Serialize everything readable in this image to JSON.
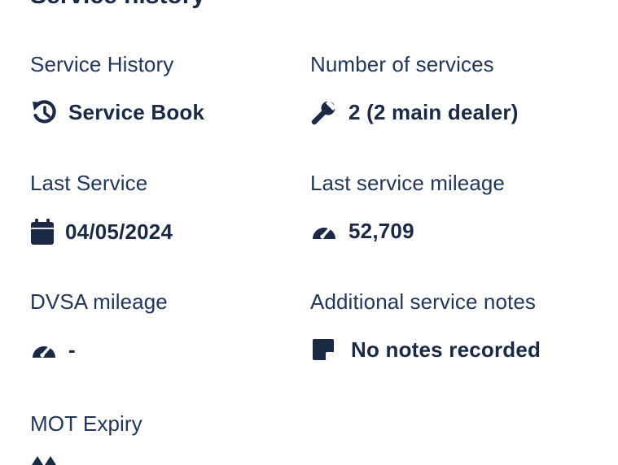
{
  "section": {
    "title": "Service history"
  },
  "fields": {
    "service_history": {
      "label": "Service History",
      "value": "Service Book",
      "icon": "history-icon"
    },
    "number_of_services": {
      "label": "Number of services",
      "value": "2 (2 main dealer)",
      "icon": "wrench-icon"
    },
    "last_service": {
      "label": "Last Service",
      "value": "04/05/2024",
      "icon": "calendar-icon"
    },
    "last_service_mileage": {
      "label": "Last service mileage",
      "value": "52,709",
      "icon": "speedometer-icon"
    },
    "dvsa_mileage": {
      "label": "DVSA mileage",
      "value": "-",
      "icon": "speedometer-icon"
    },
    "additional_service_notes": {
      "label": "Additional service notes",
      "value": "No notes recorded",
      "icon": "sticky-note-icon"
    },
    "mot_expiry": {
      "label": "MOT Expiry",
      "icon": "mot-icon"
    }
  },
  "colors": {
    "text": "#1b2a44",
    "label": "#22365a",
    "background": "#ffffff"
  }
}
